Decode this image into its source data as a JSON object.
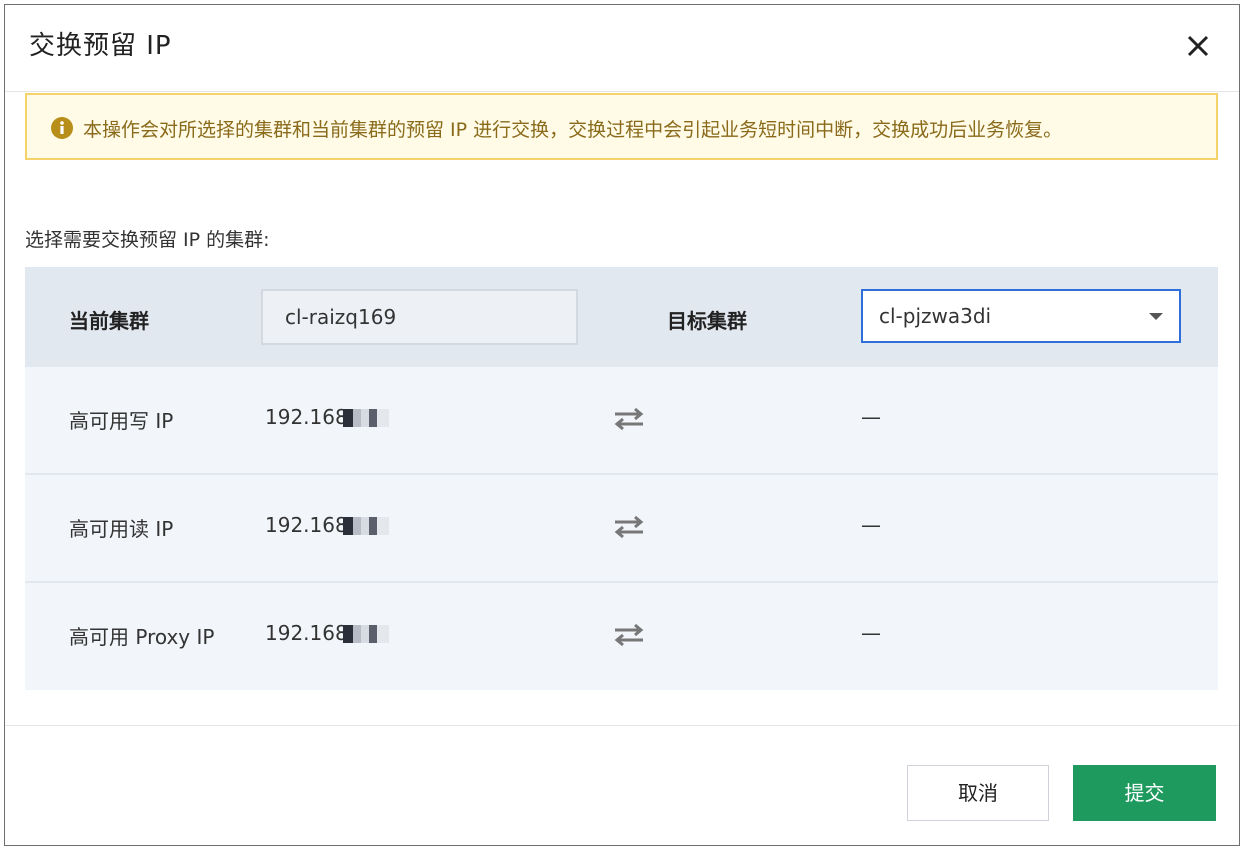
{
  "dialog": {
    "title": "交换预留 IP",
    "close_icon": "close-icon"
  },
  "alert": {
    "icon": "info-icon",
    "text": "本操作会对所选择的集群和当前集群的预留 IP 进行交换，交换过程中会引起业务短时间中断，交换成功后业务恢复。"
  },
  "select_label": "选择需要交换预留 IP 的集群:",
  "header": {
    "current_label": "当前集群",
    "current_value": "cl-raizq169",
    "target_label": "目标集群",
    "target_value": "cl-pjzwa3di"
  },
  "rows": [
    {
      "label": "高可用写 IP",
      "ip": "192.168",
      "target": "—"
    },
    {
      "label": "高可用读 IP",
      "ip": "192.168",
      "target": "—"
    },
    {
      "label": "高可用 Proxy IP",
      "ip": "192.168",
      "target": "—"
    }
  ],
  "footer": {
    "cancel_label": "取消",
    "submit_label": "提交"
  },
  "colors": {
    "accent": "#1f9a5f",
    "alert_bg": "#fffbe6",
    "alert_border": "#f5d26a",
    "select_border": "#2f6fdc"
  }
}
